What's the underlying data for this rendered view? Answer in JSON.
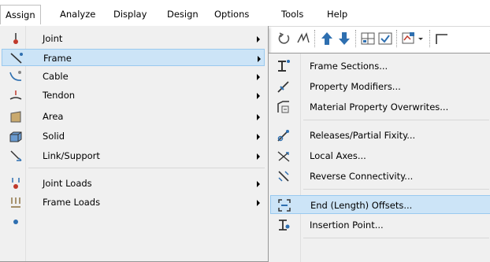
{
  "menubar": {
    "items": [
      "Assign",
      "Analyze",
      "Display",
      "Design",
      "Options",
      "Tools",
      "Help"
    ]
  },
  "assign_menu": {
    "items": [
      {
        "label": "Joint",
        "icon": "joint-icon"
      },
      {
        "label": "Frame",
        "icon": "frame-icon"
      },
      {
        "label": "Cable",
        "icon": "cable-icon"
      },
      {
        "label": "Tendon",
        "icon": "tendon-icon"
      },
      {
        "label": "Area",
        "icon": "area-icon"
      },
      {
        "label": "Solid",
        "icon": "solid-icon"
      },
      {
        "label": "Link/Support",
        "icon": "link-support-icon"
      },
      {
        "label": "Joint Loads",
        "icon": "joint-loads-icon"
      },
      {
        "label": "Frame Loads",
        "icon": "frame-loads-icon"
      }
    ],
    "highlighted": "Frame"
  },
  "frame_submenu": {
    "items": [
      {
        "label": "Frame Sections...",
        "icon": "frame-sections-icon"
      },
      {
        "label": "Property Modifiers...",
        "icon": "property-modifiers-icon"
      },
      {
        "label": "Material Property Overwrites...",
        "icon": "material-overwrites-icon"
      },
      {
        "label": "Releases/Partial Fixity...",
        "icon": "releases-icon"
      },
      {
        "label": "Local Axes...",
        "icon": "local-axes-icon"
      },
      {
        "label": "Reverse Connectivity...",
        "icon": "reverse-connectivity-icon"
      },
      {
        "label": "End (Length) Offsets...",
        "icon": "end-offsets-icon"
      },
      {
        "label": "Insertion Point...",
        "icon": "insertion-point-icon"
      }
    ],
    "highlighted": "End (Length) Offsets..."
  },
  "colors": {
    "highlight_bg": "#cce4f7",
    "highlight_border": "#99c9ef",
    "menu_bg": "#f0f0f0",
    "icon_red": "#c0392b",
    "icon_blue": "#2e6fb0"
  }
}
